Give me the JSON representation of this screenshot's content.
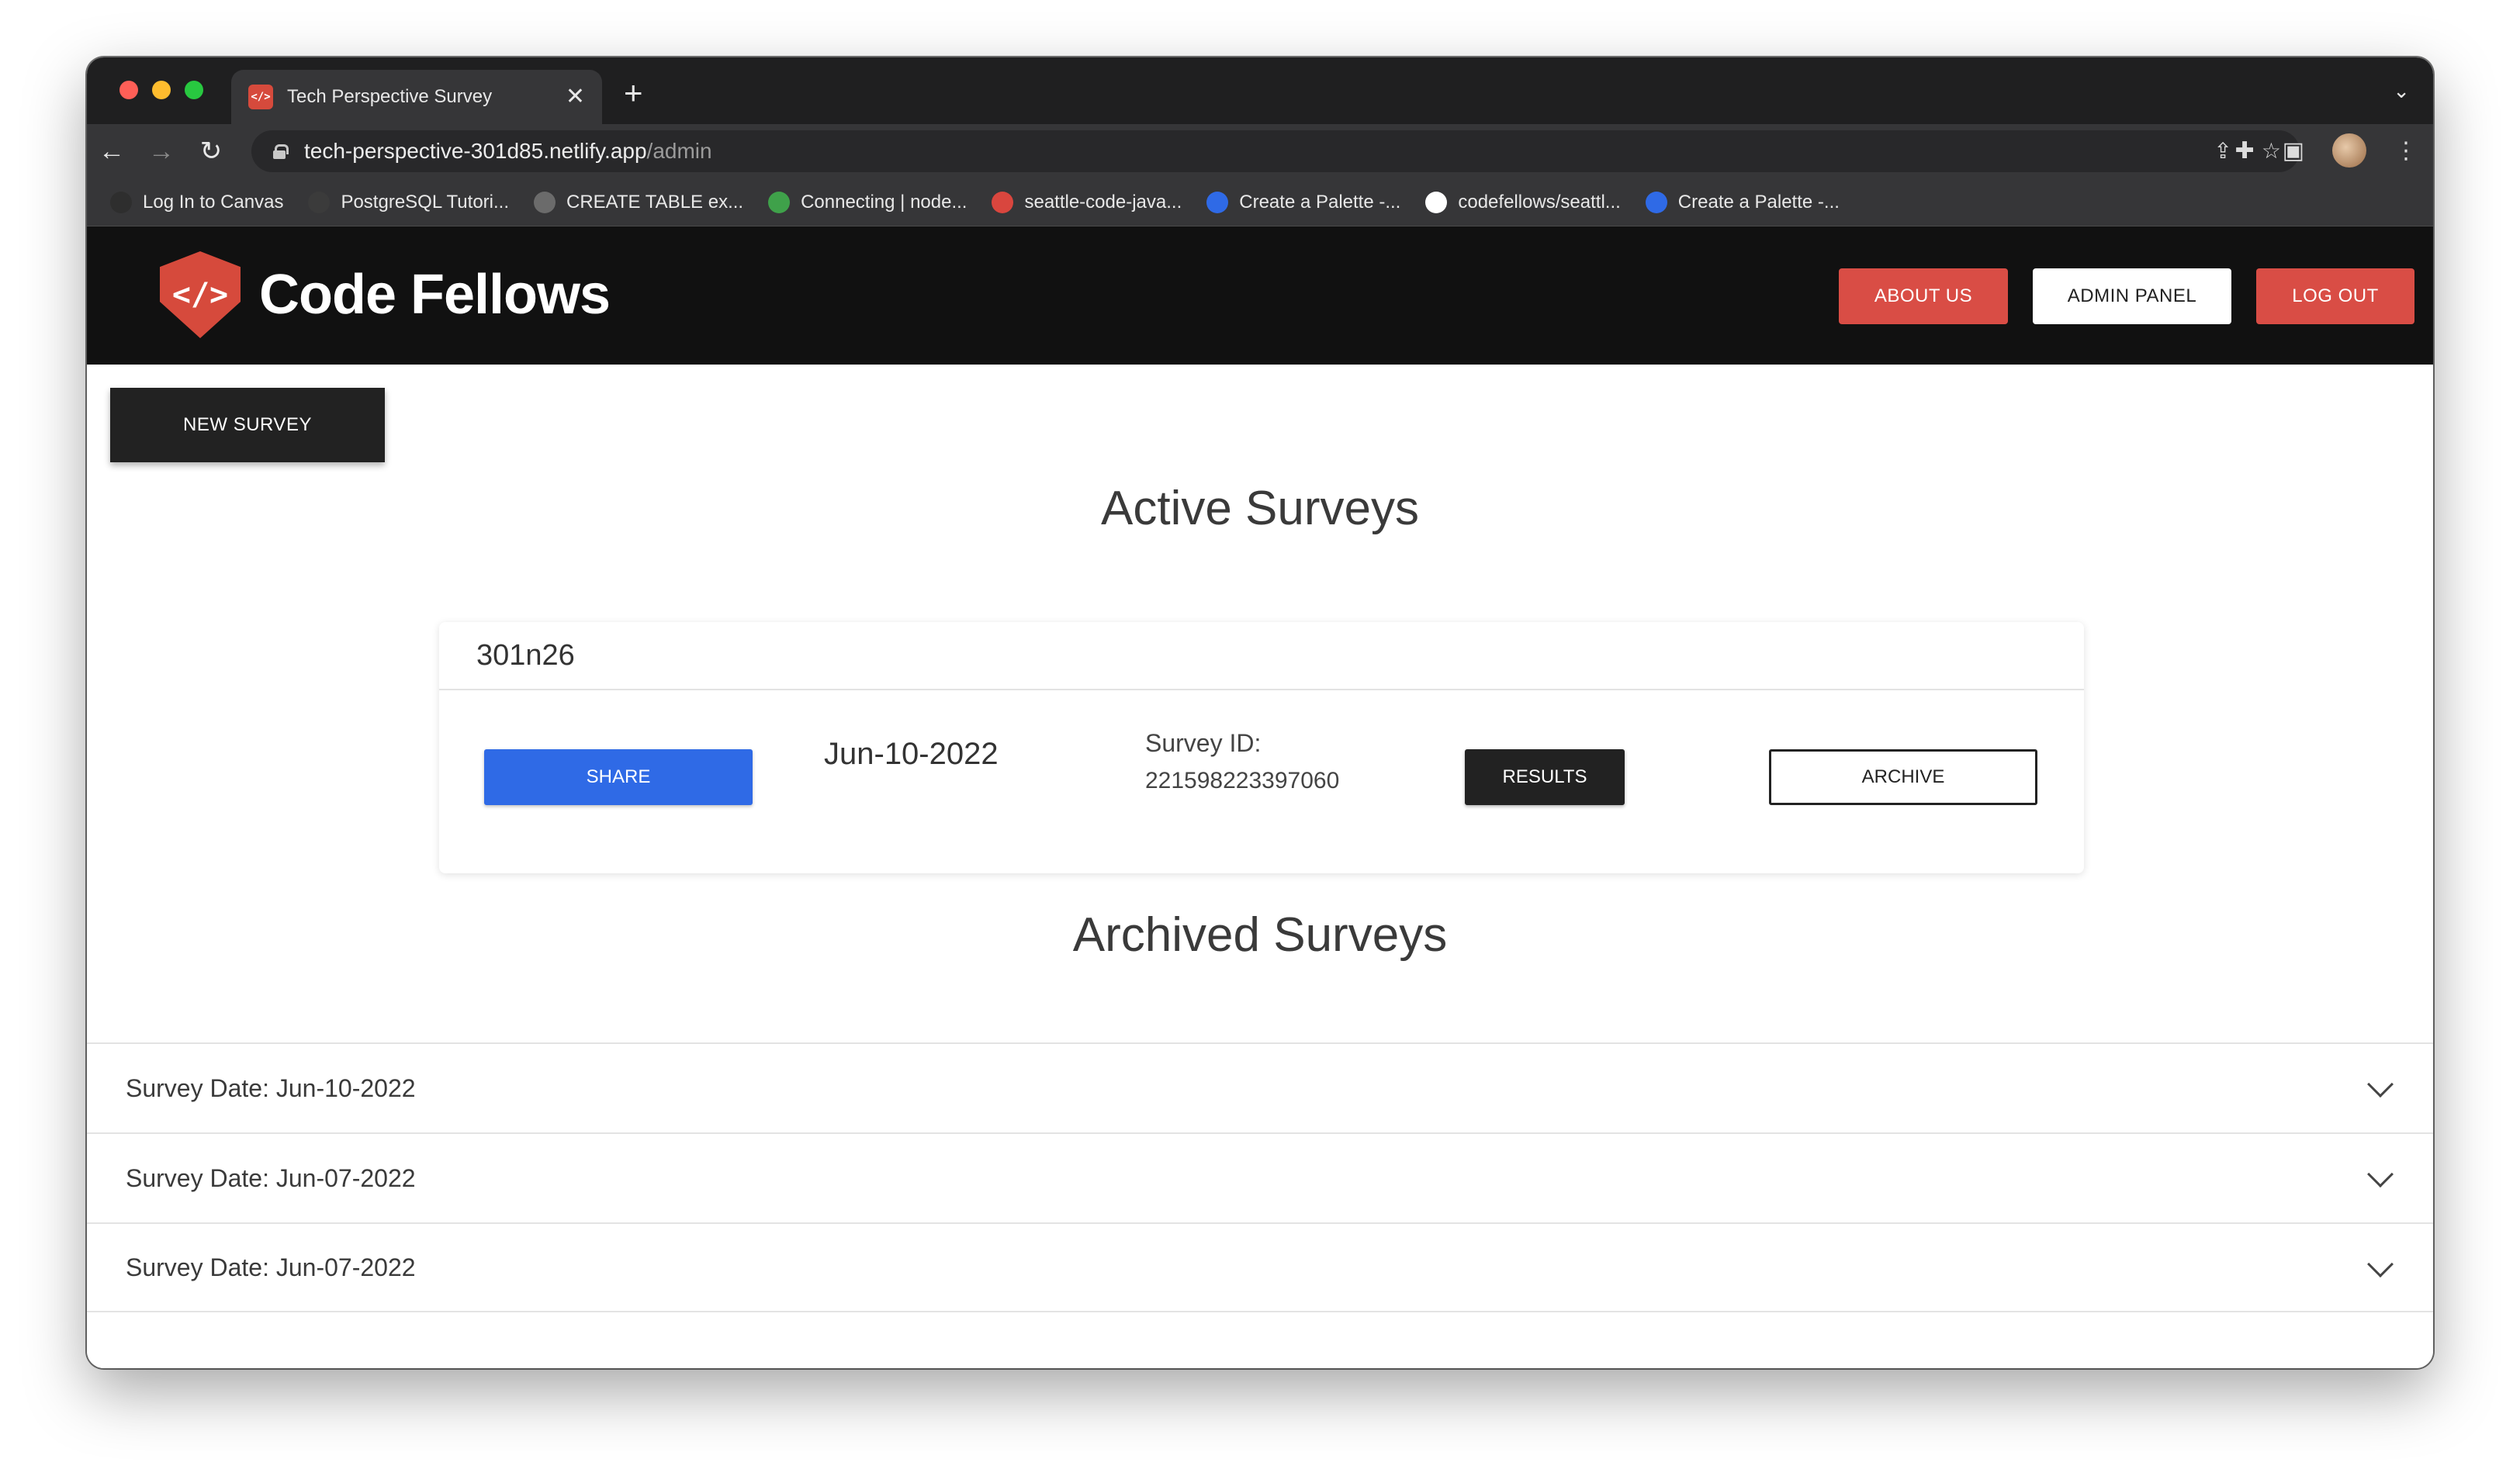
{
  "browser": {
    "tab_title": "Tech Perspective Survey",
    "favicon_text": "</>",
    "new_tab_symbol": "+",
    "close_symbol": "✕",
    "url_host": "tech-perspective-301d85.netlify.app",
    "url_path": "/admin",
    "bookmarks": [
      {
        "label": "Log In to Canvas",
        "icon": "canvas-icon",
        "color": "#2e2e2e"
      },
      {
        "label": "PostgreSQL Tutori...",
        "icon": "postgres-icon",
        "color": "#3b3b3b"
      },
      {
        "label": "CREATE TABLE ex...",
        "icon": "globe-icon",
        "color": "#6b6b6b"
      },
      {
        "label": "Connecting | node...",
        "icon": "node-icon",
        "color": "#3fa14a"
      },
      {
        "label": "seattle-code-java...",
        "icon": "java-icon",
        "color": "#d9463e"
      },
      {
        "label": "Create a Palette -...",
        "icon": "palette-icon",
        "color": "#2f6ae6"
      },
      {
        "label": "codefellows/seattl...",
        "icon": "github-icon",
        "color": "#ffffff"
      },
      {
        "label": "Create a Palette -...",
        "icon": "palette-icon",
        "color": "#2f6ae6"
      }
    ]
  },
  "header": {
    "logo_text": "Code Fellows",
    "logo_mark": "</>",
    "nav": {
      "about": "ABOUT US",
      "admin": "ADMIN PANEL",
      "logout": "LOG OUT"
    }
  },
  "main": {
    "new_survey": "NEW SURVEY",
    "active_title": "Active Surveys",
    "archived_title": "Archived Surveys",
    "active_survey": {
      "name": "301n26",
      "share": "SHARE",
      "date": "Jun-10-2022",
      "id_label": "Survey ID:",
      "id_value": "221598223397060",
      "results": "RESULTS",
      "archive": "ARCHIVE"
    },
    "archived": [
      {
        "label": "Survey Date: Jun-10-2022"
      },
      {
        "label": "Survey Date: Jun-07-2022"
      },
      {
        "label": "Survey Date: Jun-07-2022"
      }
    ]
  },
  "colors": {
    "brand_red": "#d94d45",
    "share_blue": "#2f6ae6",
    "header_bg": "#111111"
  }
}
